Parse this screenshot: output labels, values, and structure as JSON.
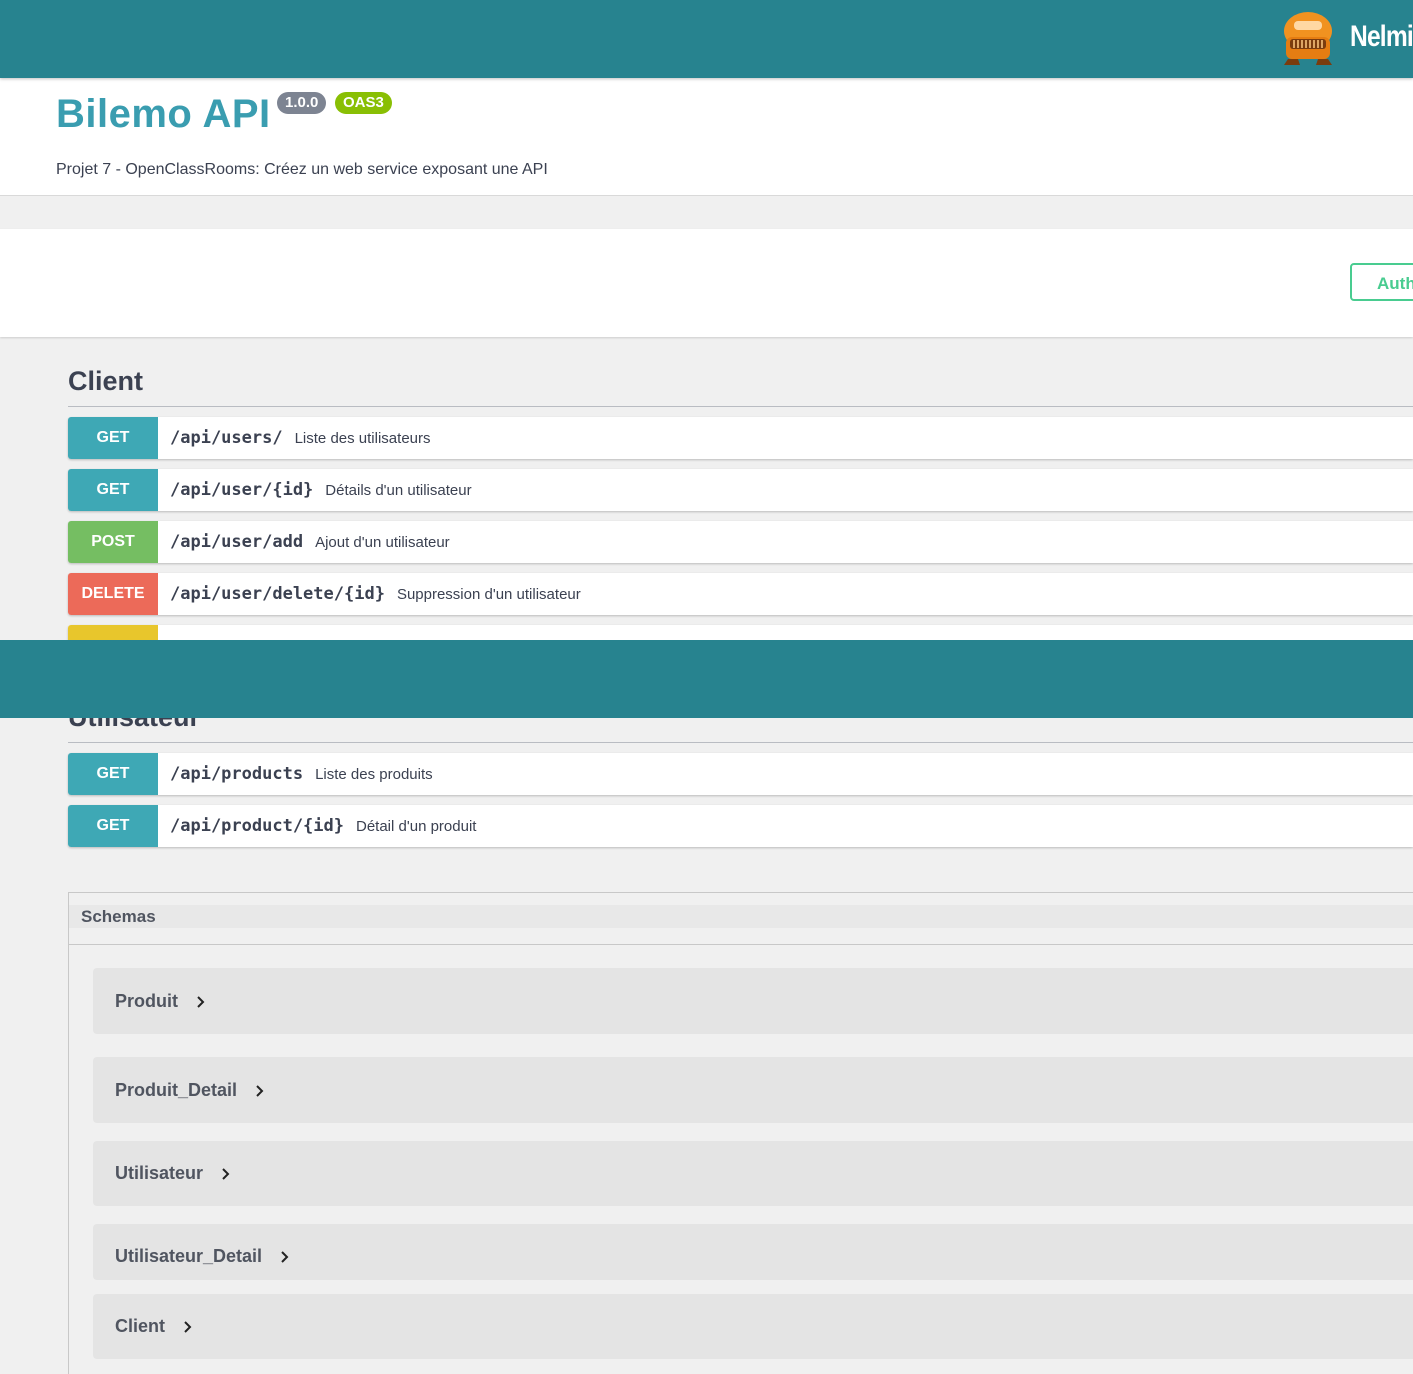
{
  "brand": {
    "name": "Nelmio",
    "logo_icon": "orange-robot-logo-icon"
  },
  "info": {
    "title": "Bilemo API",
    "version": "1.0.0",
    "oas": "OAS3",
    "description": "Projet 7 - OpenClassRooms: Créez un web service exposant une API"
  },
  "authorize": {
    "label": "Auth"
  },
  "tags": [
    {
      "name": "Client",
      "operations": [
        {
          "method": "GET",
          "path": "/api/users/",
          "summary": "Liste des utilisateurs"
        },
        {
          "method": "GET",
          "path": "/api/user/{id}",
          "summary": "Détails d'un utilisateur"
        },
        {
          "method": "POST",
          "path": "/api/user/add",
          "summary": "Ajout d'un utilisateur"
        },
        {
          "method": "DELETE",
          "path": "/api/user/delete/{id}",
          "summary": "Suppression d'un utilisateur"
        }
      ]
    },
    {
      "name": "Utilisateur",
      "operations": [
        {
          "method": "GET",
          "path": "/api/products",
          "summary": "Liste des produits"
        },
        {
          "method": "GET",
          "path": "/api/product/{id}",
          "summary": "Détail d'un produit"
        }
      ]
    }
  ],
  "schemas": {
    "title": "Schemas",
    "models": [
      "Produit",
      "Produit_Detail",
      "Utilisateur",
      "Utilisateur_Detail",
      "Client"
    ]
  },
  "colors": {
    "header": "#27838f",
    "title": "#3a9db0",
    "get": "#3ea8b5",
    "post": "#75be62",
    "delete": "#ec6a59",
    "put": "#e8c62c",
    "authorize": "#49cc90"
  }
}
